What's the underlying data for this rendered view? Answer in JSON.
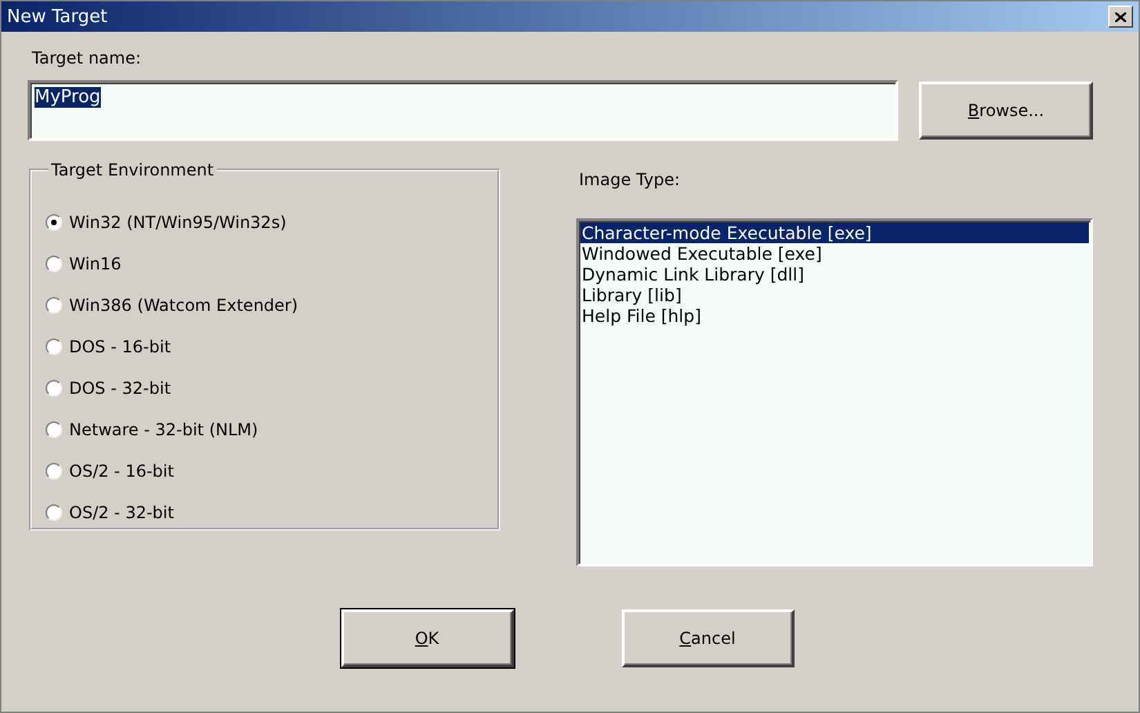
{
  "window": {
    "title": "New Target"
  },
  "target_name": {
    "label": "Target name:",
    "value": "MyProg",
    "value_selected": true
  },
  "browse_button": {
    "label": "Browse...",
    "underline_first": true
  },
  "target_environment": {
    "title": "Target Environment",
    "options": [
      {
        "label": "Win32 (NT/Win95/Win32s)",
        "selected": true
      },
      {
        "label": "Win16",
        "selected": false
      },
      {
        "label": "Win386 (Watcom Extender)",
        "selected": false
      },
      {
        "label": "DOS - 16-bit",
        "selected": false
      },
      {
        "label": "DOS - 32-bit",
        "selected": false
      },
      {
        "label": "Netware - 32-bit (NLM)",
        "selected": false
      },
      {
        "label": "OS/2 - 16-bit",
        "selected": false
      },
      {
        "label": "OS/2 - 32-bit",
        "selected": false
      }
    ]
  },
  "image_type": {
    "label": "Image Type:",
    "items": [
      {
        "label": "Character-mode Executable [exe]",
        "selected": true
      },
      {
        "label": "Windowed Executable [exe]",
        "selected": false
      },
      {
        "label": "Dynamic Link Library [dll]",
        "selected": false
      },
      {
        "label": "Library [lib]",
        "selected": false
      },
      {
        "label": "Help File [hlp]",
        "selected": false
      }
    ]
  },
  "buttons": [
    {
      "label": "OK",
      "default": true,
      "underline_first": true
    },
    {
      "label": "Cancel",
      "default": false,
      "underline_first": true
    }
  ]
}
